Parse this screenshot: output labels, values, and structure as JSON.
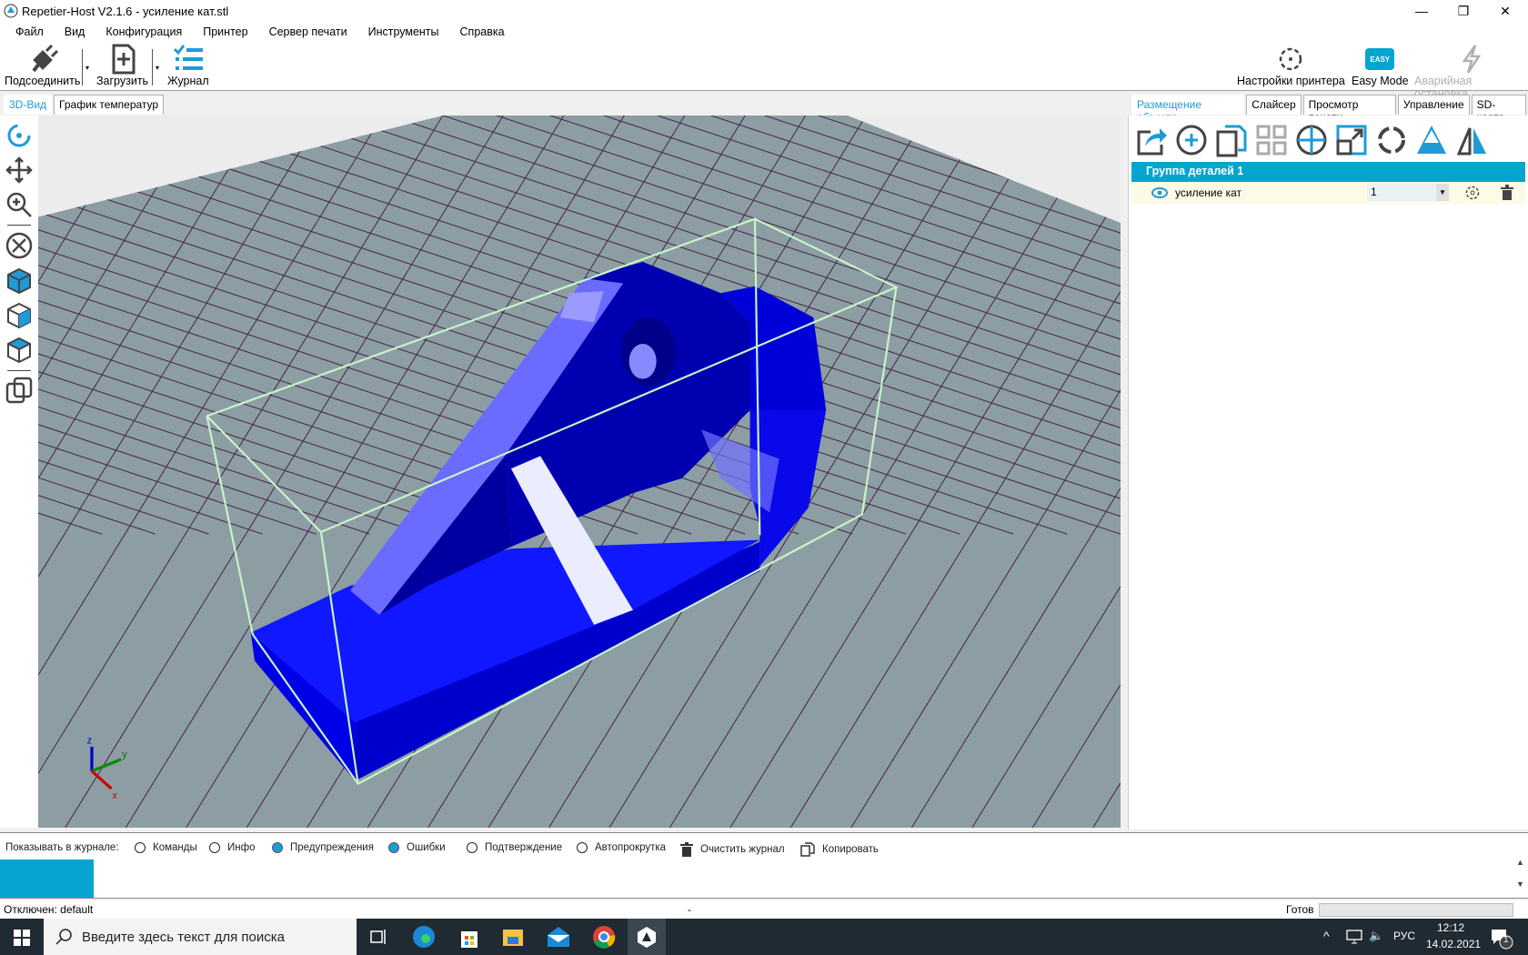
{
  "window": {
    "title": "Repetier-Host V2.1.6 - усиление кат.stl",
    "min": "—",
    "restore": "❐",
    "close": "✕"
  },
  "menu": [
    "Файл",
    "Вид",
    "Конфигурация",
    "Принтер",
    "Сервер печати",
    "Инструменты",
    "Справка"
  ],
  "toolbar": {
    "connect": "Подсоединить",
    "load": "Загрузить",
    "log": "Журнал",
    "printer_settings": "Настройки принтера",
    "easy_mode": "Easy Mode",
    "easy_badge": "EASY",
    "emergency_stop": "Аварийная остановка"
  },
  "left_tabs": [
    "3D-Вид",
    "График температур"
  ],
  "right_tabs": [
    "Размещение объекта",
    "Слайсер",
    "Просмотр печати",
    "Управление",
    "SD-карта"
  ],
  "object_panel": {
    "group_name": "Группа деталей 1",
    "items": [
      {
        "name": "усиление кат",
        "copies": "1"
      }
    ]
  },
  "view3d": {
    "object_color": "#0000ff",
    "bed_color": "#8c9ea3",
    "grid_color": "#4a2a4a",
    "bbox_color": "#c8f5c8",
    "axes": {
      "x": "x",
      "y": "y",
      "z": "z"
    }
  },
  "log": {
    "label": "Показывать в журнале:",
    "options": [
      {
        "label": "Команды",
        "checked": false
      },
      {
        "label": "Инфо",
        "checked": false
      },
      {
        "label": "Предупреждения",
        "checked": true
      },
      {
        "label": "Ошибки",
        "checked": true
      },
      {
        "label": "Подтверждение",
        "checked": false
      },
      {
        "label": "Автопрокрутка",
        "checked": false
      }
    ],
    "clear": "Очистить журнал",
    "copy": "Копировать"
  },
  "status": {
    "connection": "Отключен: default",
    "middle": "-",
    "state": "Готов"
  },
  "taskbar": {
    "search_placeholder": "Введите здесь текст для поиска",
    "lang": "РУС",
    "time": "12:12",
    "date": "14.02.2021",
    "notifications": "1"
  },
  "accent": "#05a5d0"
}
